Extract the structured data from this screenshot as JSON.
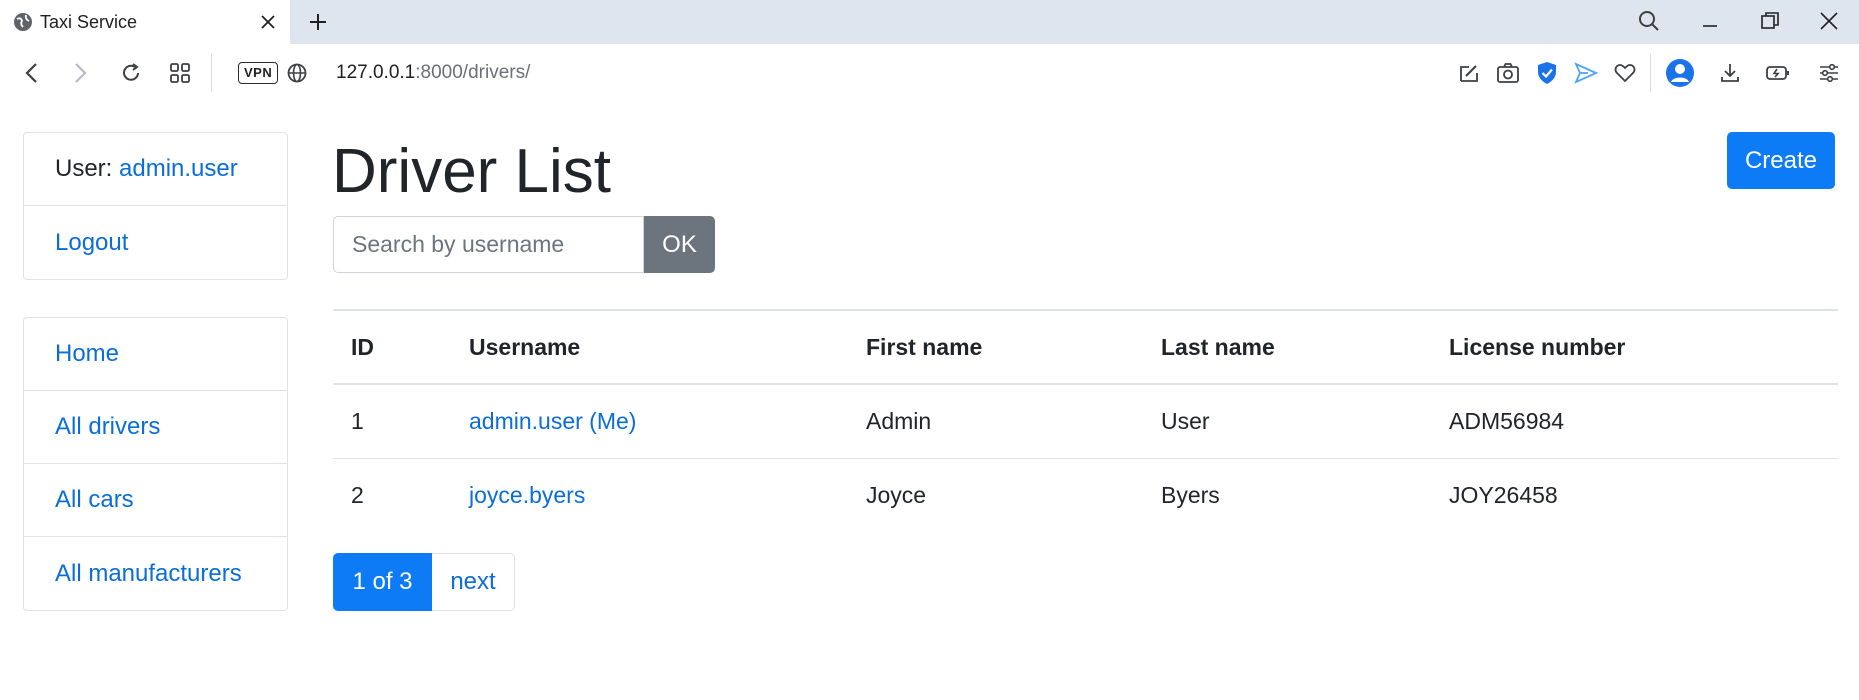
{
  "browser": {
    "tab_title": "Taxi Service",
    "vpn_label": "VPN",
    "url_host": "127.0.0.1",
    "url_path": ":8000/drivers/"
  },
  "sidebar": {
    "user_label": "User: ",
    "user_name": "admin.user",
    "logout_label": "Logout",
    "nav": [
      {
        "label": "Home"
      },
      {
        "label": "All drivers"
      },
      {
        "label": "All cars"
      },
      {
        "label": "All manufacturers"
      }
    ]
  },
  "main": {
    "title": "Driver List",
    "create_label": "Create",
    "search": {
      "placeholder": "Search by username",
      "value": "",
      "submit_label": "OK"
    },
    "table": {
      "headers": [
        "ID",
        "Username",
        "First name",
        "Last name",
        "License number"
      ],
      "rows": [
        {
          "id": "1",
          "username": "admin.user (Me)",
          "first_name": "Admin",
          "last_name": "User",
          "license": "ADM56984"
        },
        {
          "id": "2",
          "username": "joyce.byers",
          "first_name": "Joyce",
          "last_name": "Byers",
          "license": "JOY26458"
        }
      ]
    },
    "pagination": {
      "current": "1 of 3",
      "next_label": "next"
    }
  },
  "colors": {
    "primary": "#0e7bf6",
    "link": "#0a6dd8",
    "secondary": "#6c757d",
    "tabbar": "#dee5ef"
  }
}
